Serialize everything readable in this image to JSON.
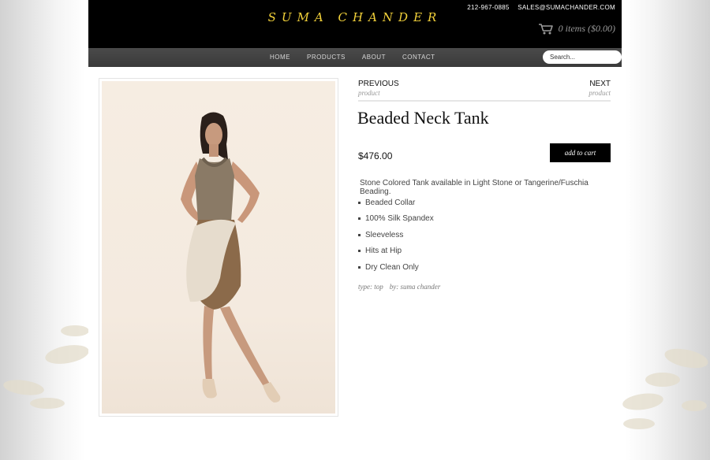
{
  "site": {
    "logo": "SUMA CHANDER",
    "phone": "212-967-0885",
    "email": "SALES@SUMACHANDER.COM",
    "cart_summary": "0 items ($0.00)"
  },
  "nav": {
    "items": [
      {
        "label": "HOME"
      },
      {
        "label": "PRODUCTS"
      },
      {
        "label": "ABOUT"
      },
      {
        "label": "CONTACT"
      }
    ],
    "search_placeholder": "Search..."
  },
  "product": {
    "prev_label": "PREVIOUS",
    "prev_sub": "product",
    "next_label": "NEXT",
    "next_sub": "product",
    "title": "Beaded Neck Tank",
    "price": "$476.00",
    "add_to_cart": "add to cart",
    "description": "Stone Colored Tank available in Light Stone or Tangerine/Fuschia Beading.",
    "features": [
      "Beaded Collar",
      "100% Silk Spandex",
      "Sleeveless",
      "Hits at Hip",
      "Dry Clean Only"
    ],
    "type_text": "type: top",
    "by_text": "by: suma chander"
  },
  "colors": {
    "header_bg": "#000000",
    "logo": "#f2d13a",
    "nav_bg": "#404040",
    "button_bg": "#000000"
  },
  "icons": [
    "cart-icon"
  ]
}
